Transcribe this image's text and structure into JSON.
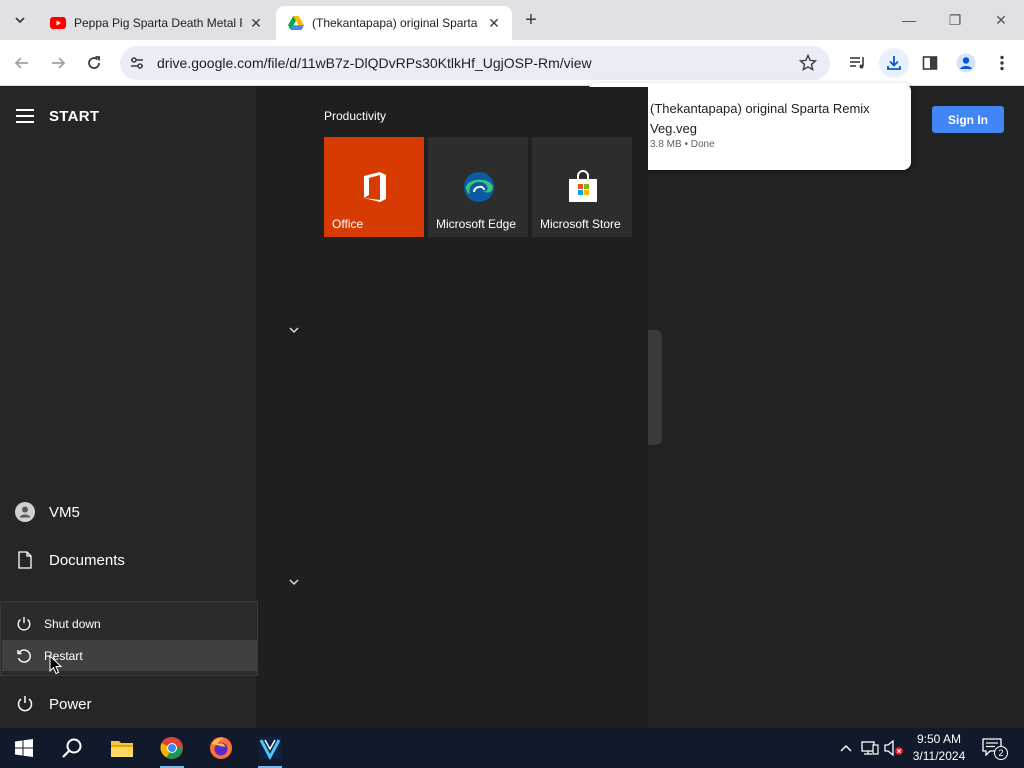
{
  "browser": {
    "tabs": [
      {
        "title": "Peppa Pig Sparta Death Metal Rem",
        "favicon": "youtube-icon",
        "active": false
      },
      {
        "title": "(Thekantapapa) original Sparta R",
        "favicon": "google-drive-icon",
        "active": true
      }
    ],
    "new_tab": "+",
    "window_controls": {
      "minimize": "—",
      "restore": "❐",
      "close": "✕"
    },
    "url": "drive.google.com/file/d/11wB7z-DlQDvRPs30KtlkHf_UgjOSP-Rm/view"
  },
  "drive_page": {
    "sign_in_label": "Sign In"
  },
  "download_bubble": {
    "filename": "(Thekantapapa) original Sparta Remix Veg.veg",
    "status": "3.8 MB • Done"
  },
  "start_menu": {
    "title": "START",
    "user": "VM5",
    "documents": "Documents",
    "power": "Power",
    "power_options": {
      "shutdown": "Shut down",
      "restart": "Restart"
    },
    "group_label": "Productivity",
    "tiles": [
      {
        "label": "Office",
        "color": "#d83b01",
        "icon": "office-icon"
      },
      {
        "label": "Microsoft Edge",
        "color": "#2d2d2d",
        "icon": "edge-icon"
      },
      {
        "label": "Microsoft Store",
        "color": "#2d2d2d",
        "icon": "store-icon"
      }
    ]
  },
  "taskbar": {
    "clock_time": "9:50 AM",
    "clock_date": "3/11/2024",
    "notification_count": "2"
  },
  "colors": {
    "accent_blue": "#4285f4",
    "office_orange": "#d83b01",
    "taskbar": "#101a2b"
  }
}
